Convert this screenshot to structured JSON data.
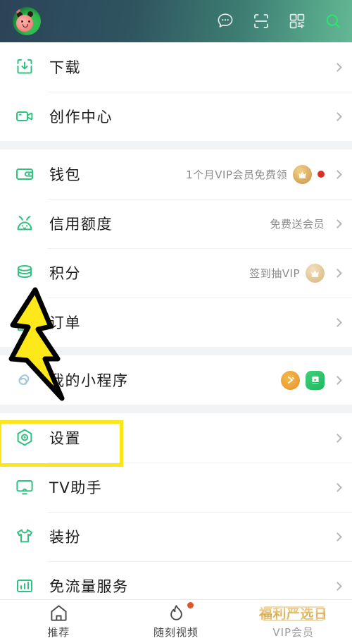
{
  "header": {
    "avatar_name": "user-avatar",
    "icons": [
      {
        "name": "message-icon",
        "label": "消息"
      },
      {
        "name": "scan-icon",
        "label": "扫一扫"
      },
      {
        "name": "qrcode-icon",
        "label": "二维码"
      },
      {
        "name": "search-icon",
        "label": "搜索"
      }
    ],
    "gradient_from": "#2b4358",
    "gradient_to": "#63b894"
  },
  "accent_color": "#2ec27e",
  "highlight_color": "#fbe719",
  "groups": [
    {
      "rows": [
        {
          "icon": "download-icon",
          "label": "下载",
          "note": "",
          "badges": []
        },
        {
          "icon": "creation-center-icon",
          "label": "创作中心",
          "note": "",
          "badges": []
        }
      ]
    },
    {
      "rows": [
        {
          "icon": "wallet-icon",
          "label": "钱包",
          "note": "1个月VIP会员免费领",
          "badges": [
            "crown-badge",
            "red-dot"
          ]
        },
        {
          "icon": "credit-icon",
          "label": "信用额度",
          "note": "免费送会员",
          "badges": []
        },
        {
          "icon": "points-icon",
          "label": "积分",
          "note": "签到抽VIP",
          "badges": [
            "crown-badge-muted"
          ]
        },
        {
          "icon": "orders-icon",
          "label": "订单",
          "note": "",
          "badges": []
        }
      ]
    },
    {
      "rows": [
        {
          "icon": "mini-program-icon",
          "label": "我的小程序",
          "note": "",
          "badges": [
            "mini-app-orange",
            "mini-app-green"
          ]
        }
      ]
    },
    {
      "rows": [
        {
          "icon": "settings-icon",
          "label": "设置",
          "note": "",
          "badges": [],
          "highlighted": true
        },
        {
          "icon": "tv-icon",
          "label": "TV助手",
          "note": "",
          "badges": []
        },
        {
          "icon": "dressup-icon",
          "label": "装扮",
          "note": "",
          "badges": []
        },
        {
          "icon": "free-data-icon",
          "label": "免流量服务",
          "note": "",
          "badges": []
        }
      ]
    }
  ],
  "annotation": {
    "lightning_name": "lightning-arrow-annotation",
    "lightning_fill": "#ffe81a",
    "lightning_stroke": "#000000"
  },
  "bottom_nav": [
    {
      "icon": "home-icon",
      "label": "推荐",
      "dot": false
    },
    {
      "icon": "flame-icon",
      "label": "随刻视频",
      "dot": true
    },
    {
      "icon": "vip-banner",
      "label": "VIP会员",
      "banner_text": "福利严选日",
      "dot": false
    }
  ]
}
